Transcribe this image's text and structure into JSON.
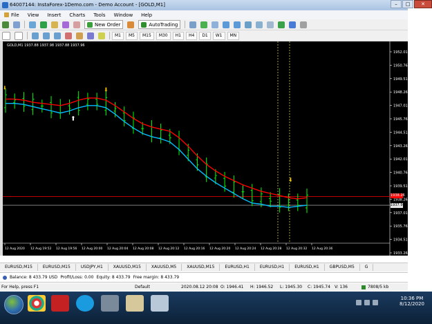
{
  "window": {
    "title": "64007144: InstaForex-1Demo.com - Demo Account - [GOLD,M1]",
    "buttons": {
      "minimize": "–",
      "maximize": "□",
      "close": "✕"
    }
  },
  "menu": [
    "File",
    "View",
    "Insert",
    "Charts",
    "Tools",
    "Window",
    "Help"
  ],
  "toolbar": {
    "new_order_label": "New Order",
    "autotrading_label": "AutoTrading",
    "timeframes": [
      "M1",
      "M5",
      "M15",
      "M30",
      "H1",
      "H4",
      "D1",
      "W1",
      "MN"
    ]
  },
  "chart": {
    "title": "GOLD,M1  1937.88 1937.98 1937.88 1937.96",
    "colors": {
      "background": "#000000",
      "candle": "#00ff00",
      "ma_fast": "#ff0000",
      "ma_slow": "#00bfff",
      "vline": "#d4c860",
      "hline_ask": "#ff0000",
      "hline_bid": "#cccccc",
      "arrow_up": "#ffffff",
      "arrow_down": "#f0c000"
    },
    "price_labels": [
      "1952.01",
      "1950.76",
      "1949.51",
      "1948.26",
      "1947.01",
      "1945.76",
      "1944.51",
      "1943.26",
      "1942.01",
      "1940.76",
      "1939.51",
      "1938.26",
      "1937.01",
      "1935.76",
      "1934.51",
      "1933.26"
    ],
    "ask_tag": "1938.26",
    "bid_tag": "1937.96",
    "time_labels": [
      "12 Aug 2020",
      "12 Aug 19:52",
      "12 Aug 19:56",
      "12 Aug 20:00",
      "12 Aug 20:04",
      "12 Aug 20:08",
      "12 Aug 20:12",
      "12 Aug 20:16",
      "12 Aug 20:20",
      "12 Aug 20:24",
      "12 Aug 20:28",
      "12 Aug 20:32",
      "12 Aug 20:36"
    ]
  },
  "chart_data": {
    "type": "line",
    "ylim": [
      1933.26,
      1952.01
    ],
    "series": [
      {
        "values": [
          1947.6,
          1947.6,
          1947.5,
          1947.3,
          1947.2,
          1947.1,
          1947.0,
          1947.2,
          1947.5,
          1947.7,
          1947.7,
          1947.5,
          1947.0,
          1946.4,
          1945.8,
          1945.3,
          1945.0,
          1944.8,
          1944.6,
          1944.0,
          1943.2,
          1942.3,
          1941.5,
          1940.9,
          1940.4,
          1940.0,
          1939.6,
          1939.3,
          1939.0,
          1938.8,
          1938.6,
          1938.4,
          1938.3,
          1938.4
        ]
      },
      {
        "values": [
          1947.2,
          1947.2,
          1947.1,
          1946.9,
          1946.7,
          1946.5,
          1946.3,
          1946.5,
          1946.8,
          1947.0,
          1947.0,
          1946.8,
          1946.2,
          1945.5,
          1944.9,
          1944.4,
          1944.1,
          1943.9,
          1943.6,
          1942.9,
          1942.0,
          1941.1,
          1940.4,
          1939.8,
          1939.3,
          1938.8,
          1938.3,
          1937.9,
          1937.8,
          1937.6,
          1937.6,
          1937.5,
          1937.6,
          1937.7
        ]
      }
    ]
  },
  "tabs": [
    "EURUSD,M15",
    "EURUSD,M15",
    "USDJPY,H1",
    "XAUUSD,M15",
    "XAUUSD,M5",
    "XAUUSD,M15",
    "EURUSD,H1",
    "EURUSD,H1",
    "EURUSD,H1",
    "GBPUSD,M5",
    "G"
  ],
  "terminal": {
    "balance": "Balance: 8 433.79 USD",
    "profit": "Profit/Loss: 0.00",
    "equity": "Equity: 8 433.79",
    "free_margin": "Free margin: 8 433.79"
  },
  "status": {
    "help": "For Help, press F1",
    "profile": "Default",
    "time": "2020.08.12 20:08",
    "open": "O: 1946.41",
    "high": "H: 1946.52",
    "low": "L: 1945.30",
    "close": "C: 1945.74",
    "volume": "V: 136",
    "traffic": "7808/5 kb"
  },
  "taskbar": {
    "time": "10:36 PM",
    "date": "8/12/2020"
  }
}
